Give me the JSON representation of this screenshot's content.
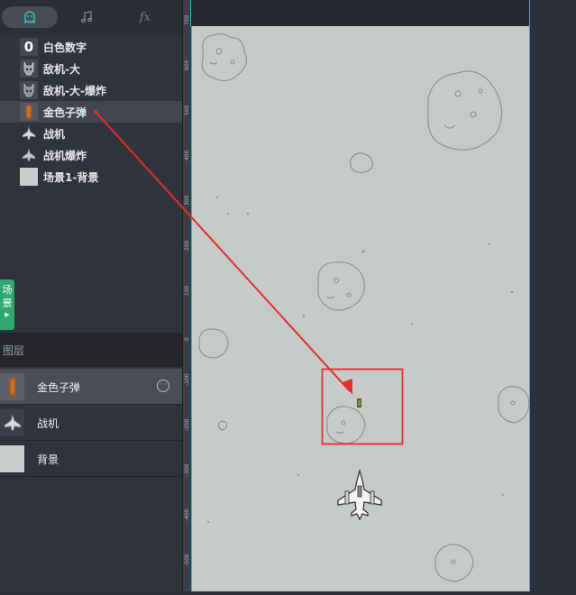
{
  "tabs": {
    "active": "ghost-icon",
    "items": [
      "ghost-icon",
      "music-icon",
      "fx-icon"
    ],
    "fx_label": "fx"
  },
  "assets": [
    {
      "label": "白色数字",
      "icon": "number-zero-icon",
      "glyph": "0"
    },
    {
      "label": "敌机-大",
      "icon": "enemy-large-icon"
    },
    {
      "label": "敌机-大-爆炸",
      "icon": "enemy-explosion-icon"
    },
    {
      "label": "金色子弹",
      "icon": "gold-bullet-icon",
      "selected": true
    },
    {
      "label": "战机",
      "icon": "fighter-icon"
    },
    {
      "label": "战机爆炸",
      "icon": "fighter-explosion-icon"
    },
    {
      "label": "场景1-背景",
      "icon": "background-thumb-icon"
    }
  ],
  "scene_tab": {
    "line1": "场",
    "line2": "景"
  },
  "layers": {
    "title": "图层",
    "items": [
      {
        "label": "金色子弹",
        "selected": true
      },
      {
        "label": "战机"
      },
      {
        "label": "背景"
      }
    ]
  },
  "ruler": {
    "ticks": [
      "700",
      "600",
      "500",
      "400",
      "300",
      "200",
      "100",
      "0",
      "-100",
      "-200",
      "-300",
      "-400",
      "-500"
    ]
  },
  "colors": {
    "accent": "#2fb2c4",
    "scene_tab": "#2fa86f",
    "annotation": "#e52d2d",
    "canvas_bg": "#c6cbca"
  }
}
